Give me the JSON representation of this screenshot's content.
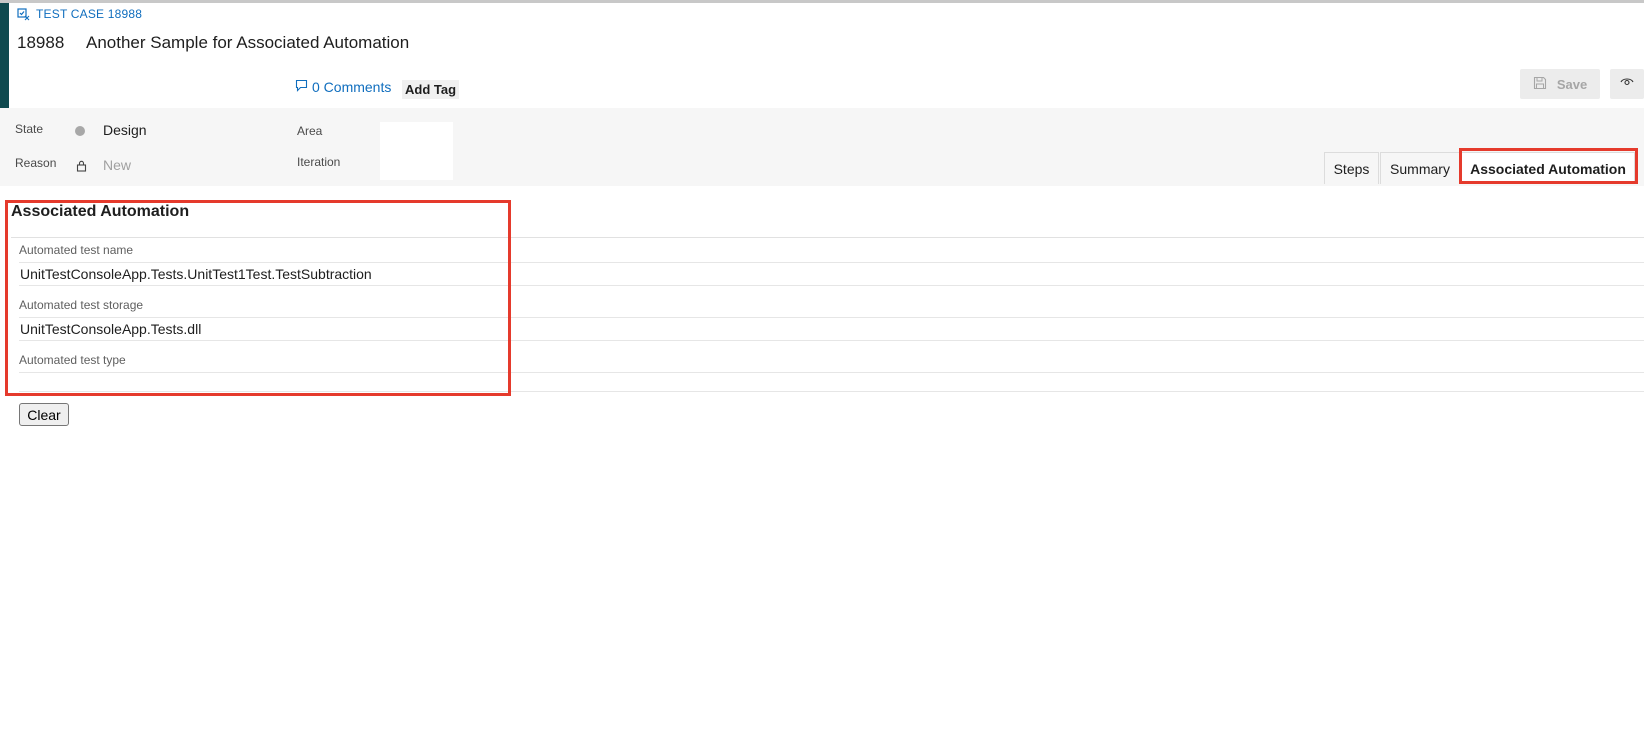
{
  "work_item": {
    "type_label": "TEST CASE 18988",
    "id": "18988",
    "title": "Another Sample for Associated Automation",
    "comments_label": "0 Comments",
    "add_tag_label": "Add Tag"
  },
  "toolbar": {
    "save_label": "Save",
    "follow_icon": "eye-icon",
    "save_icon": "floppy-disk-icon"
  },
  "fields": {
    "state_label": "State",
    "state_value": "Design",
    "reason_label": "Reason",
    "reason_value": "New",
    "area_label": "Area",
    "iteration_label": "Iteration"
  },
  "tabs": [
    {
      "label": "Steps"
    },
    {
      "label": "Summary"
    },
    {
      "label": "Associated Automation",
      "selected": true
    }
  ],
  "section": {
    "title": "Associated Automation",
    "test_name_label": "Automated test name",
    "test_name_value": "UnitTestConsoleApp.Tests.UnitTest1Test.TestSubtraction",
    "test_storage_label": "Automated test storage",
    "test_storage_value": "UnitTestConsoleApp.Tests.dll",
    "test_type_label": "Automated test type",
    "test_type_value": "",
    "clear_label": "Clear"
  },
  "colors": {
    "accent": "#0f4a4f",
    "link": "#106ebe",
    "highlight": "#e53a2c"
  }
}
